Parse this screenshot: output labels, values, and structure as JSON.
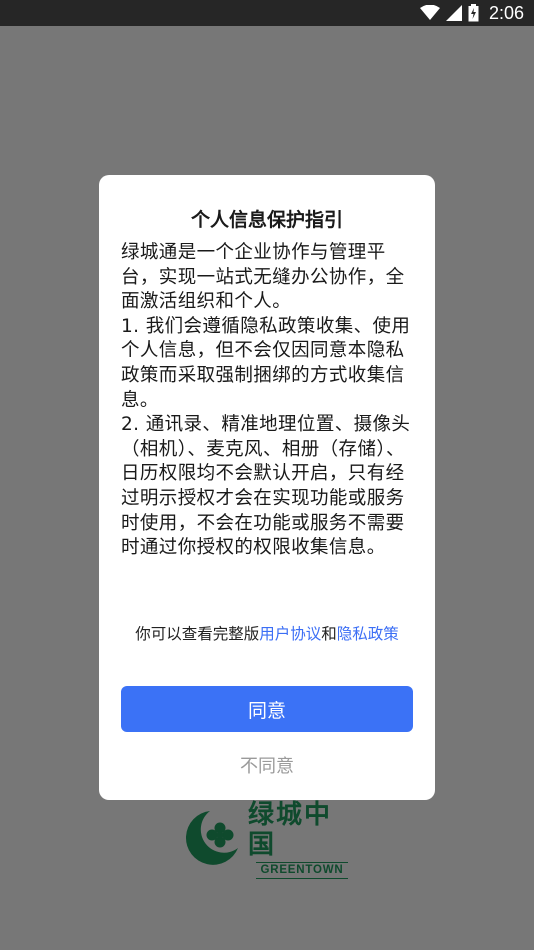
{
  "status_bar": {
    "time": "2:06",
    "icons": [
      "wifi-icon",
      "cell-signal-icon",
      "battery-charging-icon"
    ]
  },
  "dialog": {
    "title": "个人信息保护指引",
    "paragraphs": [
      "绿城通是一个企业协作与管理平台，实现一站式无缝办公协作，全面激活组织和个人。",
      "1. 我们会遵循隐私政策收集、使用个人信息，但不会仅因同意本隐私政策而采取强制捆绑的方式收集信息。",
      "2. 通讯录、精准地理位置、摄像头（相机）、麦克风、相册（存储）、日历权限均不会默认开启，只有经过明示授权才会在实现功能或服务时使用，不会在功能或服务不需要时通过你授权的权限收集信息。"
    ],
    "links_prefix": "你可以查看完整版",
    "user_agreement_link": "用户协议",
    "links_and": "和",
    "privacy_policy_link": "隐私政策",
    "agree_label": "同意",
    "disagree_label": "不同意"
  },
  "logo": {
    "name_cn": "绿城中国",
    "name_en": "GREENTOWN"
  },
  "colors": {
    "overlay": "#777777",
    "accent": "#3b72f6",
    "link": "#3b6ef5",
    "brand_green": "#0f4a2d"
  }
}
